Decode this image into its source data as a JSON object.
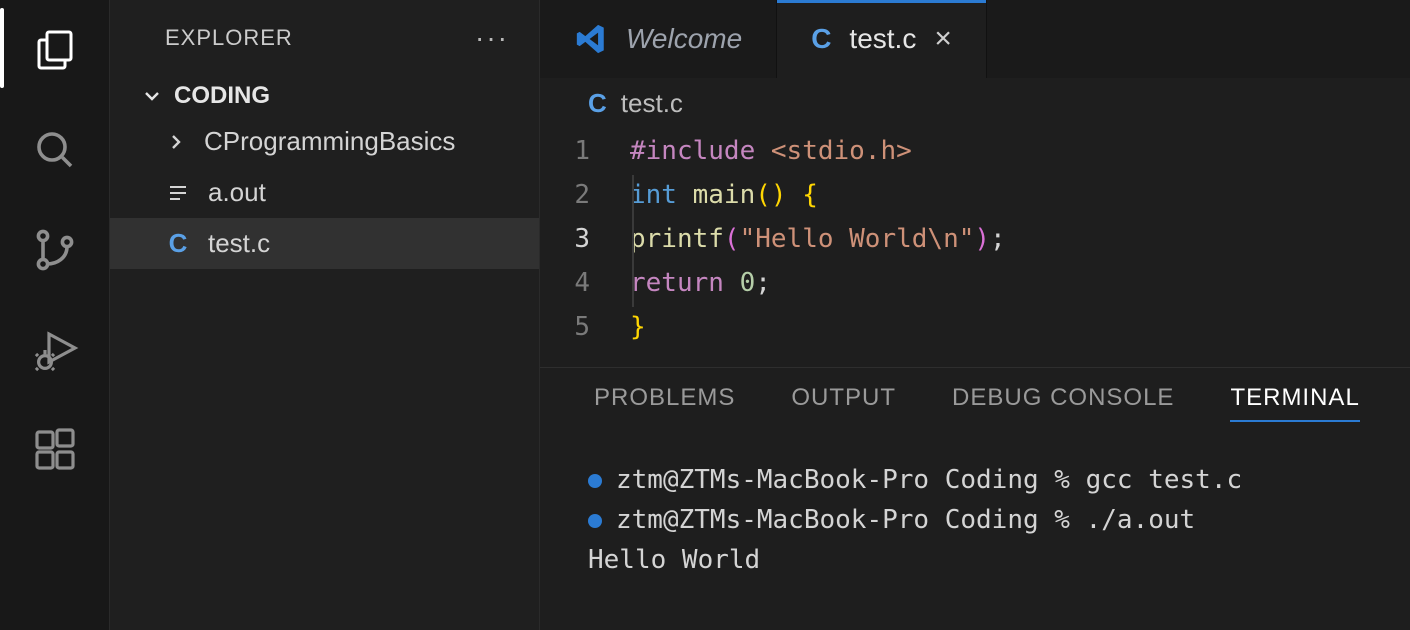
{
  "activity": {
    "items": [
      "explorer",
      "search",
      "source-control",
      "run-debug",
      "extensions"
    ],
    "active": "explorer"
  },
  "explorer": {
    "title": "EXPLORER",
    "folder": "CODING",
    "items": [
      {
        "type": "folder",
        "label": "CProgrammingBasics"
      },
      {
        "type": "file",
        "label": "a.out",
        "icon": "lines"
      },
      {
        "type": "file",
        "label": "test.c",
        "icon": "c",
        "selected": true
      }
    ]
  },
  "tabs": [
    {
      "id": "welcome",
      "label": "Welcome",
      "kind": "welcome",
      "active": false
    },
    {
      "id": "testc",
      "label": "test.c",
      "kind": "c-file",
      "active": true
    }
  ],
  "breadcrumb": {
    "icon": "C",
    "label": "test.c"
  },
  "code": {
    "lines": [
      [
        {
          "t": "#include ",
          "c": "tok-directive"
        },
        {
          "t": "<stdio.h>",
          "c": "tok-include-path"
        }
      ],
      [
        {
          "t": "int ",
          "c": "tok-keyword"
        },
        {
          "t": "main",
          "c": "tok-func"
        },
        {
          "t": "() ",
          "c": "tok-brace2"
        },
        {
          "t": "{",
          "c": "tok-brace2"
        }
      ],
      [
        {
          "t": "    ",
          "c": ""
        },
        {
          "t": "printf",
          "c": "tok-func"
        },
        {
          "t": "(",
          "c": "tok-brace"
        },
        {
          "t": "\"Hello World\\n\"",
          "c": "tok-string"
        },
        {
          "t": ")",
          "c": "tok-brace"
        },
        {
          "t": ";",
          "c": "tok-punc"
        }
      ],
      [
        {
          "t": "    ",
          "c": ""
        },
        {
          "t": "return ",
          "c": "tok-return"
        },
        {
          "t": "0",
          "c": "tok-num"
        },
        {
          "t": ";",
          "c": "tok-punc"
        }
      ],
      [
        {
          "t": "}",
          "c": "tok-brace2"
        }
      ]
    ],
    "current_line": 3
  },
  "panel": {
    "tabs": [
      "PROBLEMS",
      "OUTPUT",
      "DEBUG CONSOLE",
      "TERMINAL"
    ],
    "active": "TERMINAL"
  },
  "terminal": {
    "prompt": "ztm@ZTMs-MacBook-Pro Coding % ",
    "lines": [
      {
        "prompt": true,
        "cmd": "gcc test.c"
      },
      {
        "prompt": true,
        "cmd": "./a.out"
      },
      {
        "prompt": false,
        "cmd": "Hello World"
      }
    ]
  }
}
